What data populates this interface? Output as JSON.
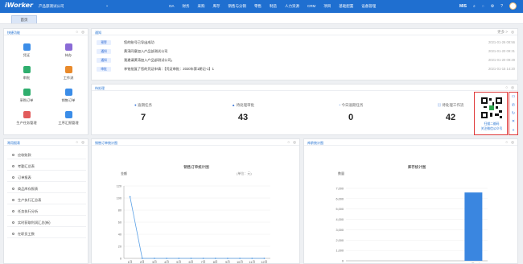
{
  "app": {
    "logo": "iWorker",
    "company": "产品部测试公司",
    "nav": [
      "OA",
      "财务",
      "采购",
      "库存",
      "销售与分销",
      "零售",
      "制造",
      "人力资源",
      "CRM",
      "项目",
      "基础配置",
      "设备管理"
    ],
    "user": "MIS",
    "tab_home": "首页"
  },
  "quick": {
    "title": "快捷功能",
    "items": [
      {
        "label": "凭证",
        "color": "#3b8de8"
      },
      {
        "label": "待办",
        "color": "#8a6bd6"
      },
      {
        "label": "审批",
        "color": "#2fae6e"
      },
      {
        "label": "工作流",
        "color": "#e98a2b"
      },
      {
        "label": "采购订单",
        "color": "#2fae6e"
      },
      {
        "label": "销售订单",
        "color": "#3b8de8"
      },
      {
        "label": "生产任务管理",
        "color": "#e25b5b"
      },
      {
        "label": "工序汇报管理",
        "color": "#3b8de8"
      }
    ]
  },
  "notice": {
    "title": "通知",
    "more": "更多 >",
    "rows": [
      {
        "tag": "预警",
        "text": "您的账号已导出成功",
        "date": "2021-01-26 08:56"
      },
      {
        "tag": "通知",
        "text": "黄涛同意加入产品部测试公司",
        "date": "2021-01-20 09:31"
      },
      {
        "tag": "通知",
        "text": "我邀请黄涛加入产品部测试公司。",
        "date": "2021-01-20 09:29"
      },
      {
        "tag": "审批",
        "text": "李铭批复了您的凭证申请：【凭证审批：2020年第1期记-1】1",
        "date": "2021-01-15 14:20"
      }
    ]
  },
  "todo": {
    "title": "待处理",
    "stats": [
      {
        "label": "逾期任务",
        "value": "7"
      },
      {
        "label": "待处理审批",
        "value": "43"
      },
      {
        "label": "今日逾期任务",
        "value": "0"
      },
      {
        "label": "待处理工作流",
        "value": "42"
      }
    ]
  },
  "qr": {
    "line1": "扫描二维码",
    "line2": "关注微信公众号"
  },
  "reports": {
    "title": "常用报表",
    "items": [
      "应收账款",
      "考勤汇总表",
      "订单报表",
      "商品库存报表",
      "生产执行汇总表",
      "任务执行分析",
      "实时获取利润汇总(新)",
      "在职员工数"
    ]
  },
  "sales_chart": {
    "panel_title": "销售订单统计图",
    "chart_data": {
      "type": "line",
      "title": "销售订单统计图",
      "ylabel": "金额",
      "unit": "(单位：元)",
      "categories": [
        "1月",
        "2月",
        "3月",
        "4月",
        "5月",
        "6月",
        "7月",
        "8月",
        "9月",
        "10月",
        "11月",
        "12月"
      ],
      "values": [
        102,
        0,
        0,
        0,
        0,
        0,
        0,
        0,
        0,
        0,
        0,
        0
      ],
      "ylim": [
        0,
        120
      ],
      "yticks": [
        0,
        20,
        40,
        60,
        80,
        100,
        120
      ]
    }
  },
  "stock_chart": {
    "panel_title": "库龄统计图",
    "chart_data": {
      "type": "bar",
      "title": "库存统计图",
      "ylabel": "数量",
      "categories": [
        "0-30天",
        "31-60天",
        "61-90天",
        "91-180天",
        "181天以上"
      ],
      "values": [
        0,
        0,
        0,
        0,
        6600
      ],
      "ylim": [
        0,
        7000
      ],
      "yticks": [
        0,
        1000,
        2000,
        3000,
        4000,
        5000,
        6000,
        7000
      ]
    }
  }
}
